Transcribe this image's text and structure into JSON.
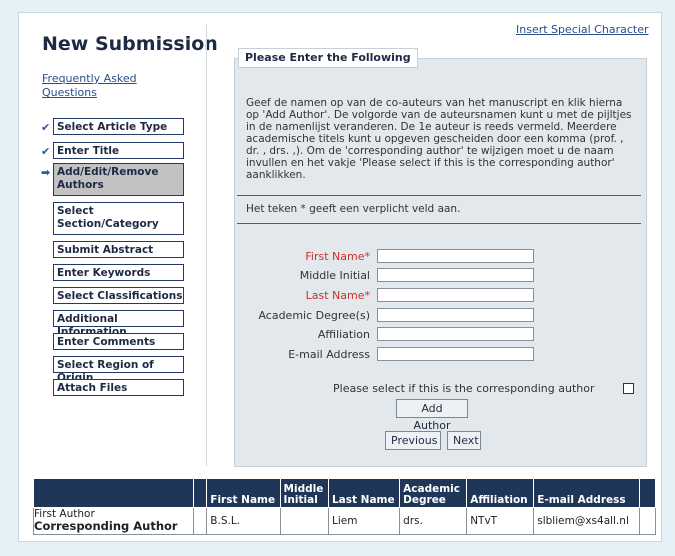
{
  "header": {
    "title": "New Submission",
    "faq_link": "Frequently Asked Questions",
    "insert_link": "Insert Special Character"
  },
  "steps": [
    {
      "label": "Select Article Type",
      "mark": "✔",
      "active": false
    },
    {
      "label": "Enter Title",
      "mark": "✔",
      "active": false
    },
    {
      "label": "Add/Edit/Remove Authors",
      "mark": "➡",
      "active": true
    },
    {
      "label": "Select Section/Category",
      "mark": "",
      "active": false
    },
    {
      "label": "Submit Abstract",
      "mark": "",
      "active": false
    },
    {
      "label": "Enter Keywords",
      "mark": "",
      "active": false
    },
    {
      "label": "Select Classifications",
      "mark": "",
      "active": false
    },
    {
      "label": "Additional Information",
      "mark": "",
      "active": false
    },
    {
      "label": "Enter Comments",
      "mark": "",
      "active": false
    },
    {
      "label": "Select Region of Origin",
      "mark": "",
      "active": false
    },
    {
      "label": "Attach Files",
      "mark": "",
      "active": false
    }
  ],
  "panel": {
    "legend": "Please Enter the Following",
    "instructions": "Geef de namen op van de co-auteurs van het manuscript en klik hierna op 'Add Author'. De volgorde van de auteursnamen kunt u met de pijltjes in de namenlijst veranderen. De 1e auteur is reeds vermeld. Meerdere academische titels kunt u opgeven gescheiden door een komma (prof. , dr. , drs. ,). Om de 'corresponding author' te wijzigen moet u de naam invullen en het vakje 'Please select if this is the corresponding author' aanklikken.",
    "required_note": "Het teken * geeft een verplicht veld aan."
  },
  "fields": [
    {
      "label": "First Name*",
      "required": true,
      "value": ""
    },
    {
      "label": "Middle Initial",
      "required": false,
      "value": ""
    },
    {
      "label": "Last Name*",
      "required": true,
      "value": ""
    },
    {
      "label": "Academic Degree(s)",
      "required": false,
      "value": ""
    },
    {
      "label": "Affiliation",
      "required": false,
      "value": ""
    },
    {
      "label": "E-mail Address",
      "required": false,
      "value": ""
    }
  ],
  "corresponding_label": "Please select if this is the corresponding author",
  "buttons": {
    "add_author": "Add Author",
    "previous": "Previous",
    "next": "Next"
  },
  "table": {
    "headers": [
      "",
      "",
      "First Name",
      "Middle Initial",
      "Last Name",
      "Academic Degree",
      "Affiliation",
      "E-mail Address",
      ""
    ],
    "rows": [
      {
        "label_line1": "First Author",
        "label_line2": "Corresponding Author",
        "first_name": "B.S.L.",
        "middle_initial": "",
        "last_name": "Liem",
        "academic_degree": "drs.",
        "affiliation": "NTvT",
        "email": "slbliem@xs4all.nl"
      }
    ]
  },
  "colors": {
    "accent": "#1f3659",
    "link": "#2a4e8a",
    "required": "#c9302c",
    "panel_bg": "#e3e8ec"
  }
}
